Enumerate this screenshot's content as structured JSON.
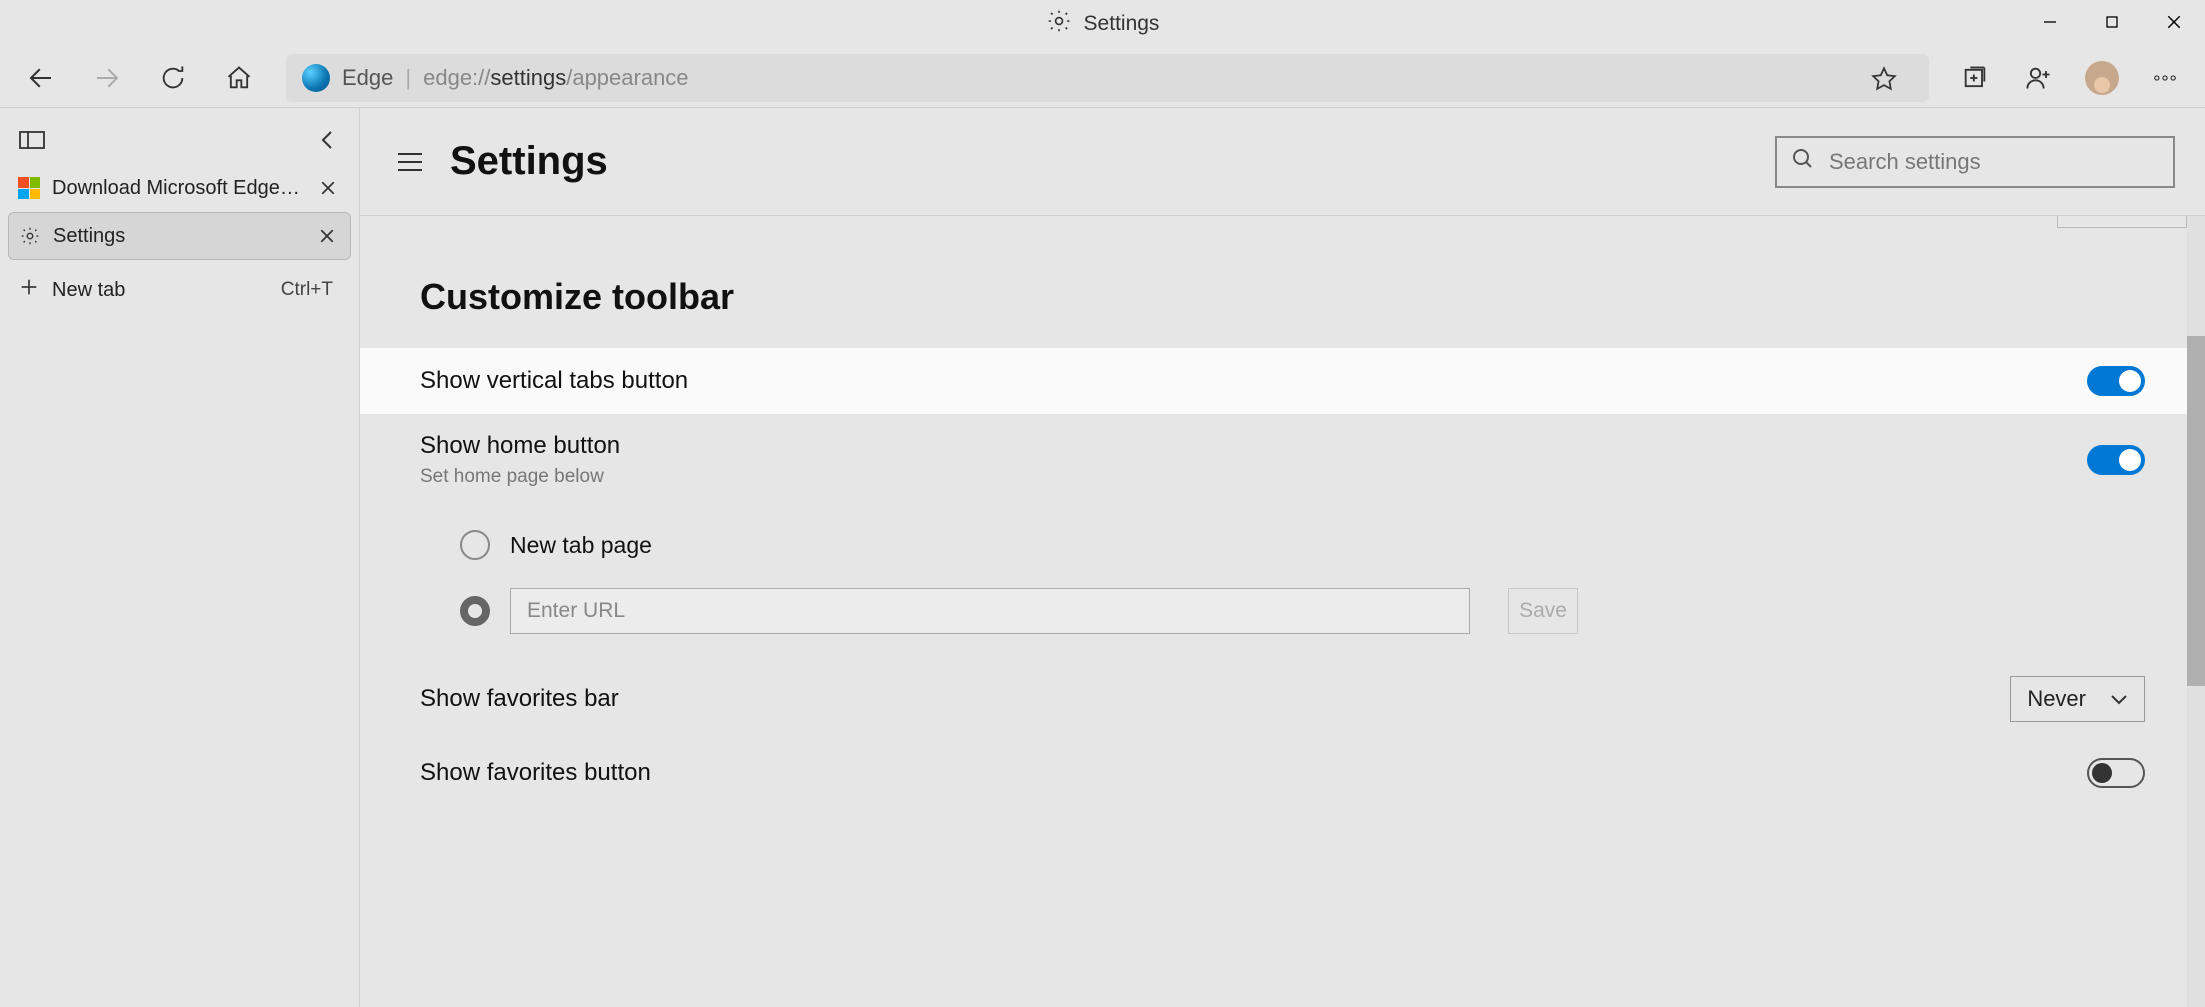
{
  "window": {
    "title": "Settings"
  },
  "toolbar": {
    "site_name": "Edge",
    "url_prefix": "edge://",
    "url_strong": "settings",
    "url_suffix": "/appearance"
  },
  "tabs": {
    "items": [
      {
        "label": "Download Microsoft Edge for Bu"
      },
      {
        "label": "Settings"
      }
    ],
    "new_tab_label": "New tab",
    "new_tab_shortcut": "Ctrl+T"
  },
  "settings": {
    "heading": "Settings",
    "search_placeholder": "Search settings",
    "section_title": "Customize toolbar",
    "rows": {
      "vertical_tabs_label": "Show vertical tabs button",
      "home_button_label": "Show home button",
      "home_button_sub": "Set home page below",
      "new_tab_page_label": "New tab page",
      "url_placeholder": "Enter URL",
      "save_label": "Save",
      "favorites_bar_label": "Show favorites bar",
      "favorites_bar_value": "Never",
      "favorites_button_label": "Show favorites button"
    }
  }
}
